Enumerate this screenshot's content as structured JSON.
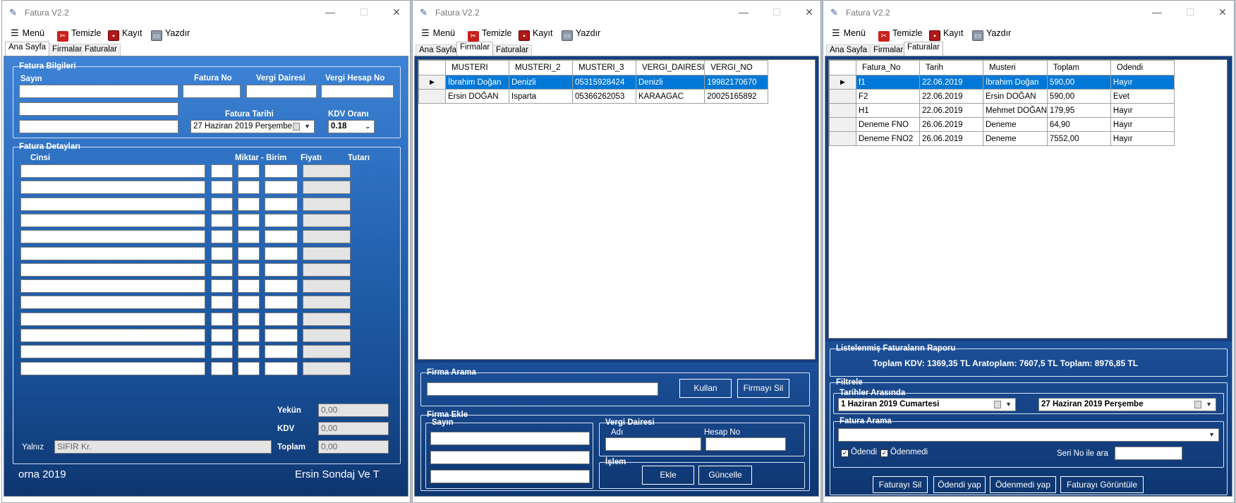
{
  "window_title": "Fatura V2.2",
  "menu": {
    "menu": "Menü",
    "temizle": "Temizle",
    "kayit": "Kayıt",
    "yazdir": "Yazdır"
  },
  "tabs": {
    "ana_sayfa": "Ana Sayfa",
    "firmalar": "Firmalar",
    "faturalar": "Faturalar"
  },
  "win1": {
    "fatura_bilgileri": {
      "group": "Fatura Bilgileri",
      "sayin": "Sayın",
      "fatura_no": "Fatura No",
      "vergi_dairesi": "Vergi Dairesi",
      "vergi_hesap_no": "Vergi Hesap No",
      "fatura_tarihi": "Fatura Tarihi",
      "fatura_tarihi_value": "27 Haziran 2019 Perşembe",
      "kdv_orani": "KDV Oranı",
      "kdv_value": "0.18"
    },
    "fatura_detaylari": {
      "group": "Fatura Detayları",
      "cinsi": "Cinsi",
      "miktar_birim": "Miktar - Birim",
      "fiyati": "Fiyatı",
      "tutari": "Tutarı",
      "yekun": "Yekün",
      "yekun_value": "0,00",
      "kdv": "KDV",
      "kdv_value": "0,00",
      "yalniz": "Yalnız",
      "yalniz_value": "SIFIR Kr.",
      "toplam": "Toplam",
      "toplam_value": "0,00"
    },
    "footer_left": "orna 2019",
    "footer_right": "Ersin Sondaj Ve T"
  },
  "win2": {
    "columns": [
      "MUSTERI",
      "MUSTERI_2",
      "MUSTERI_3",
      "VERGI_DAIRESI",
      "VERGI_NO"
    ],
    "rows": [
      [
        "İbrahim Doğan",
        "Denizli",
        "05315928424",
        "Denizli",
        "19982170670"
      ],
      [
        "Ersin DOĞAN",
        "Isparta",
        "05366262053",
        "KARAAGAC",
        "20025165892"
      ]
    ],
    "firma_arama": "Firma Arama",
    "kullan": "Kullan",
    "firmayi_sil": "Firmayı Sil",
    "firma_ekle": "Firma Ekle",
    "sayin": "Sayın",
    "vergi_dairesi": "Vergi Dairesi",
    "adi": "Adı",
    "hesap_no": "Hesap No",
    "islem": "İşlem",
    "ekle": "Ekle",
    "guncelle": "Güncelle"
  },
  "win3": {
    "columns": [
      "Fatura_No",
      "Tarih",
      "Musteri",
      "Toplam",
      "Odendi"
    ],
    "rows": [
      [
        "f1",
        "22.06.2019",
        "İbrahim Doğan",
        "590,00",
        "Hayır"
      ],
      [
        "F2",
        "22.06.2019",
        "Ersin DOĞAN",
        "590,00",
        "Evet"
      ],
      [
        "H1",
        "22.06.2019",
        "Mehmet DOĞAN",
        "179,95",
        "Hayır"
      ],
      [
        "Deneme FNO",
        "26.06.2019",
        "Deneme",
        "64,90",
        "Hayır"
      ],
      [
        "Deneme FNO2",
        "26.06.2019",
        "Deneme",
        "7552,00",
        "Hayır"
      ]
    ],
    "rapor_group": "Listelenmiş Faturaların Raporu",
    "rapor_text": "Toplam KDV: 1369,35 TL  Aratoplam: 7607,5 TL  Toplam: 8976,85 TL",
    "filtrele": "Filtrele",
    "tarihler_arasinda": "Tarihler Arasında",
    "tarih_bas": "1 Haziran 2019 Cumartesi",
    "tarih_son": "27 Haziran 2019 Perşembe",
    "fatura_arama": "Fatura Arama",
    "odendi": "Ödendi",
    "odenmedi": "Ödenmedi",
    "seri_no_ile_ara": "Seri No ile ara",
    "faturayi_sil": "Faturayı Sil",
    "odendi_yap": "Ödendi yap",
    "odenmedi_yap": "Ödenmedi yap",
    "faturayi_goruntule": "Faturayı Görüntüle"
  }
}
